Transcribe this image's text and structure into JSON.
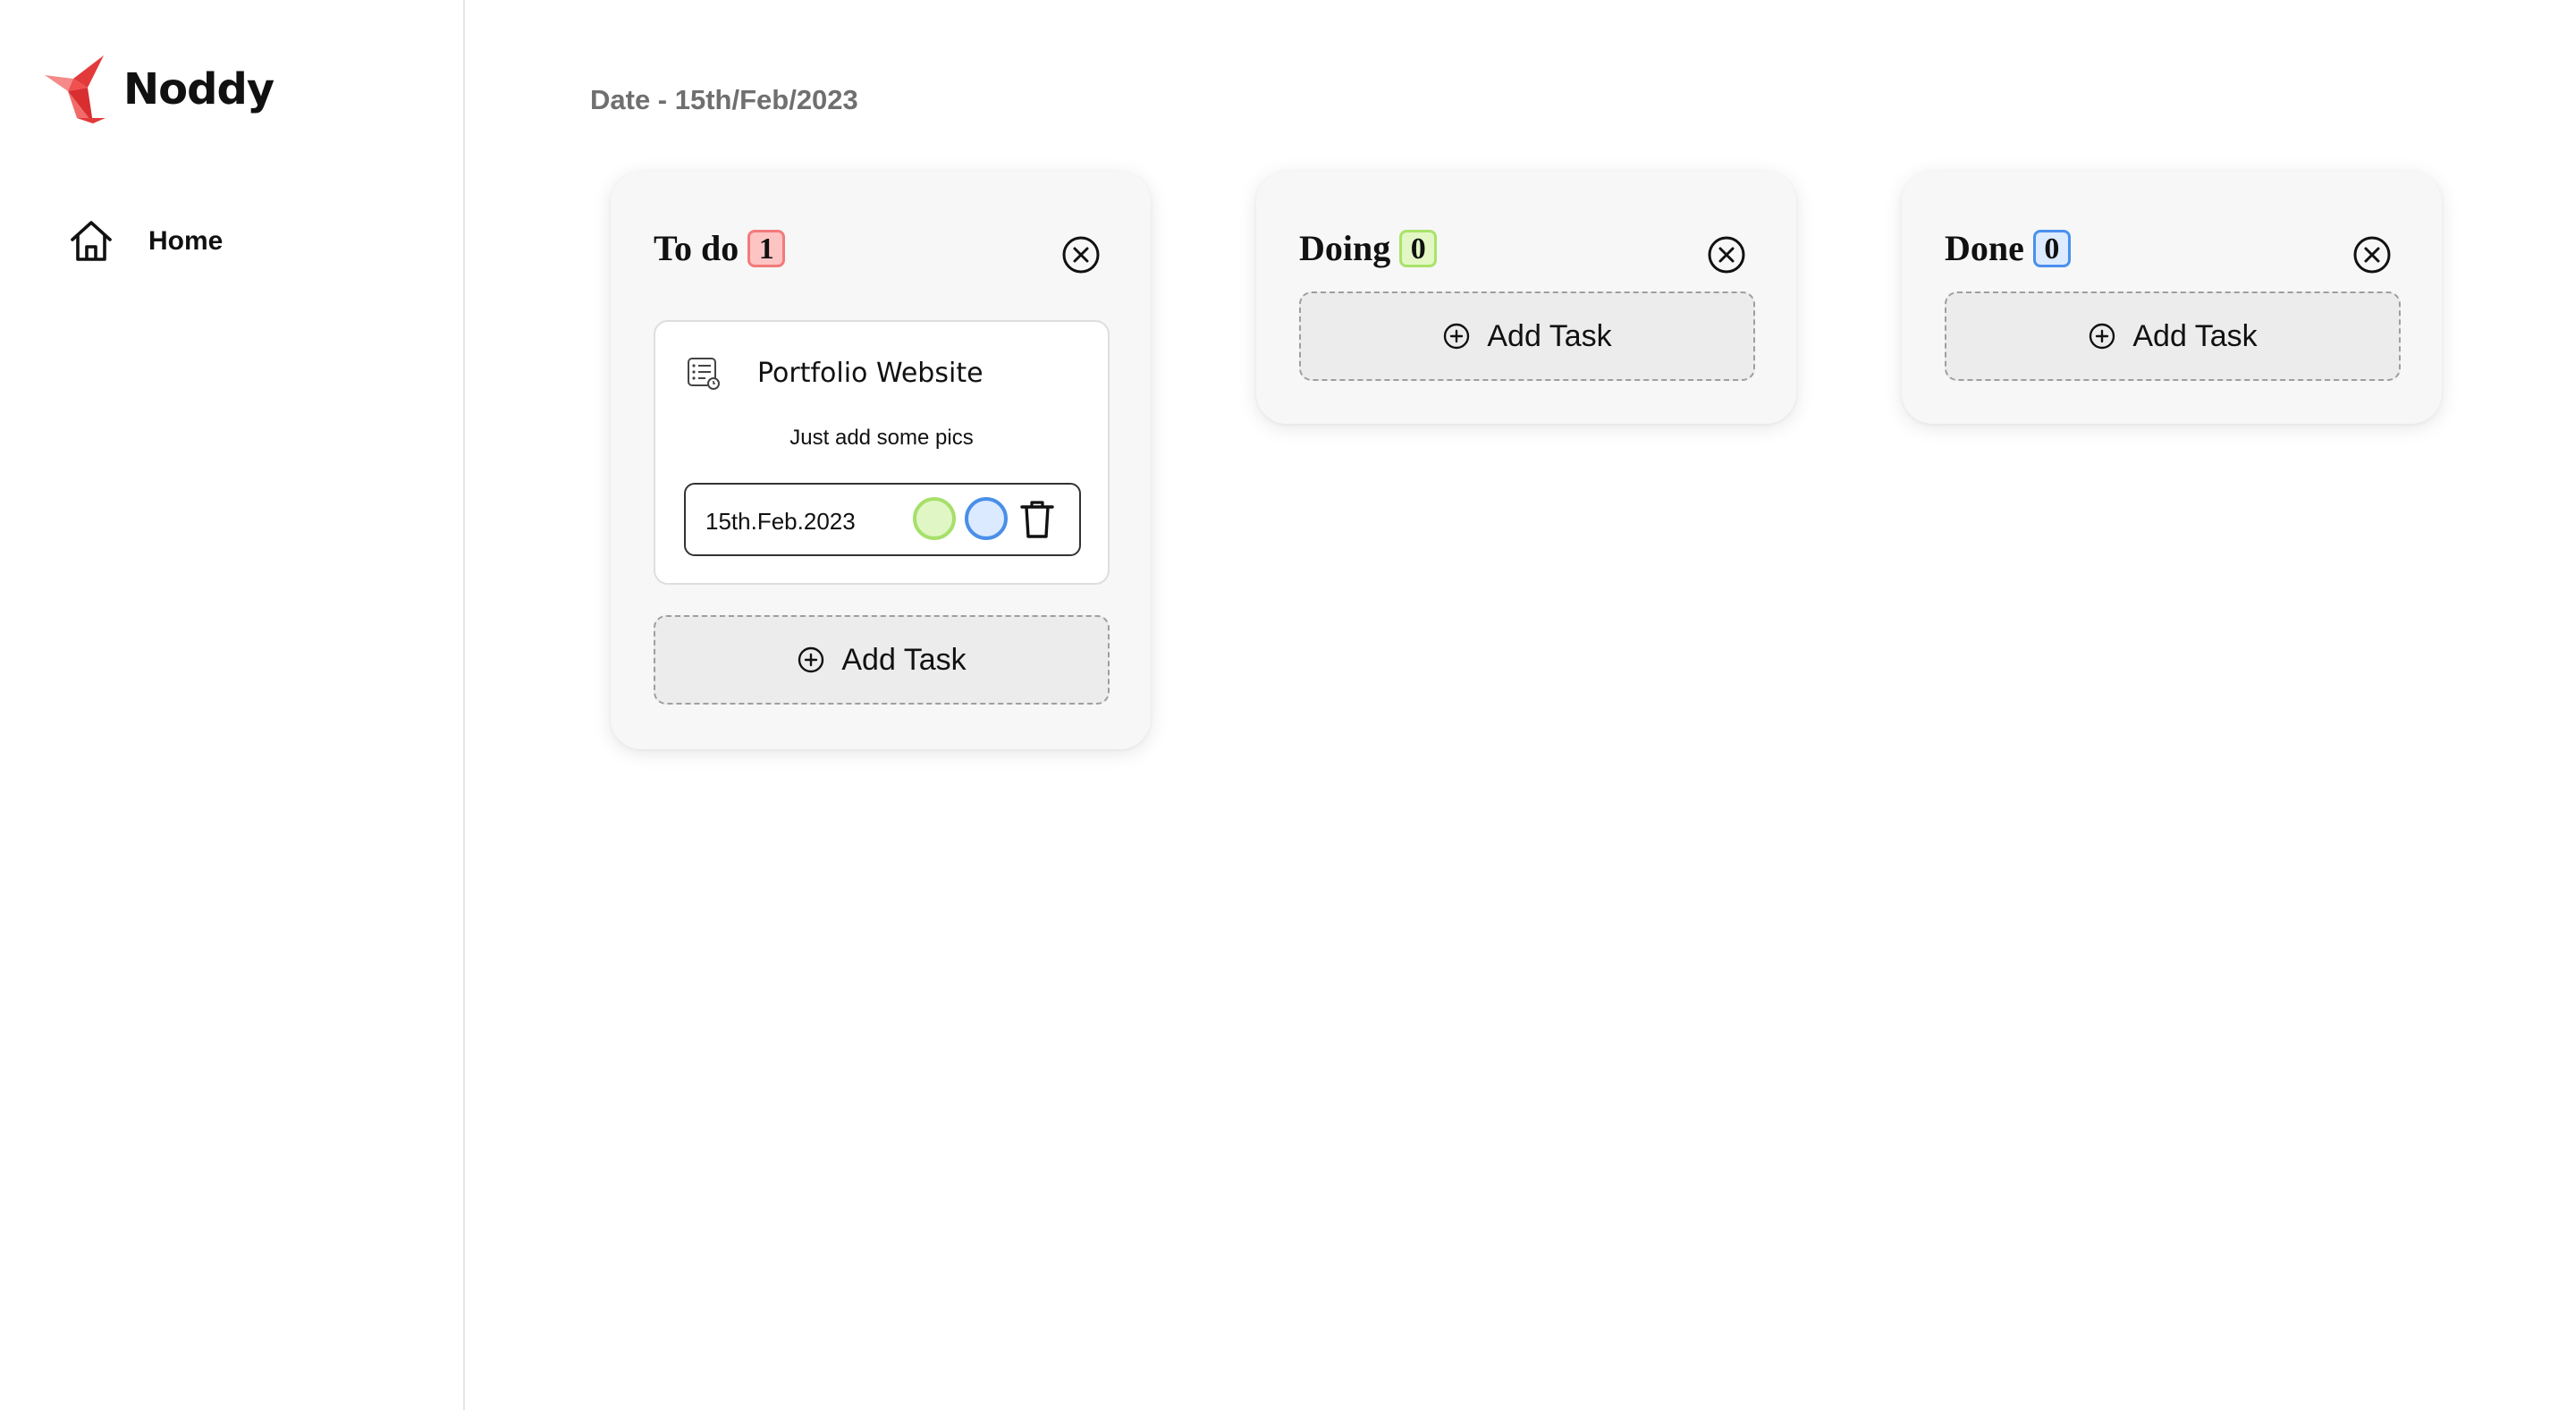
{
  "app": {
    "name": "Noddy"
  },
  "sidebar": {
    "items": [
      {
        "label": "Home",
        "icon": "home-icon"
      }
    ]
  },
  "header": {
    "date_text": "Date - 15th/Feb/2023"
  },
  "columns": [
    {
      "title": "To do",
      "count": "1",
      "badge_color": "#fdc4c4",
      "add_label": "Add Task",
      "tasks": [
        {
          "title": "Portfolio Website",
          "description": "Just add some pics",
          "date": "15th.Feb.2023",
          "icon": "task-list-icon"
        }
      ]
    },
    {
      "title": "Doing",
      "count": "0",
      "badge_color": "#e3f7c4",
      "add_label": "Add Task",
      "tasks": []
    },
    {
      "title": "Done",
      "count": "0",
      "badge_color": "#dcebff",
      "add_label": "Add Task",
      "tasks": []
    }
  ],
  "colors": {
    "brand": "#f0504f",
    "status_green": "#a6e06a",
    "status_blue": "#4a8fe8",
    "status_red": "#f37a7a"
  }
}
